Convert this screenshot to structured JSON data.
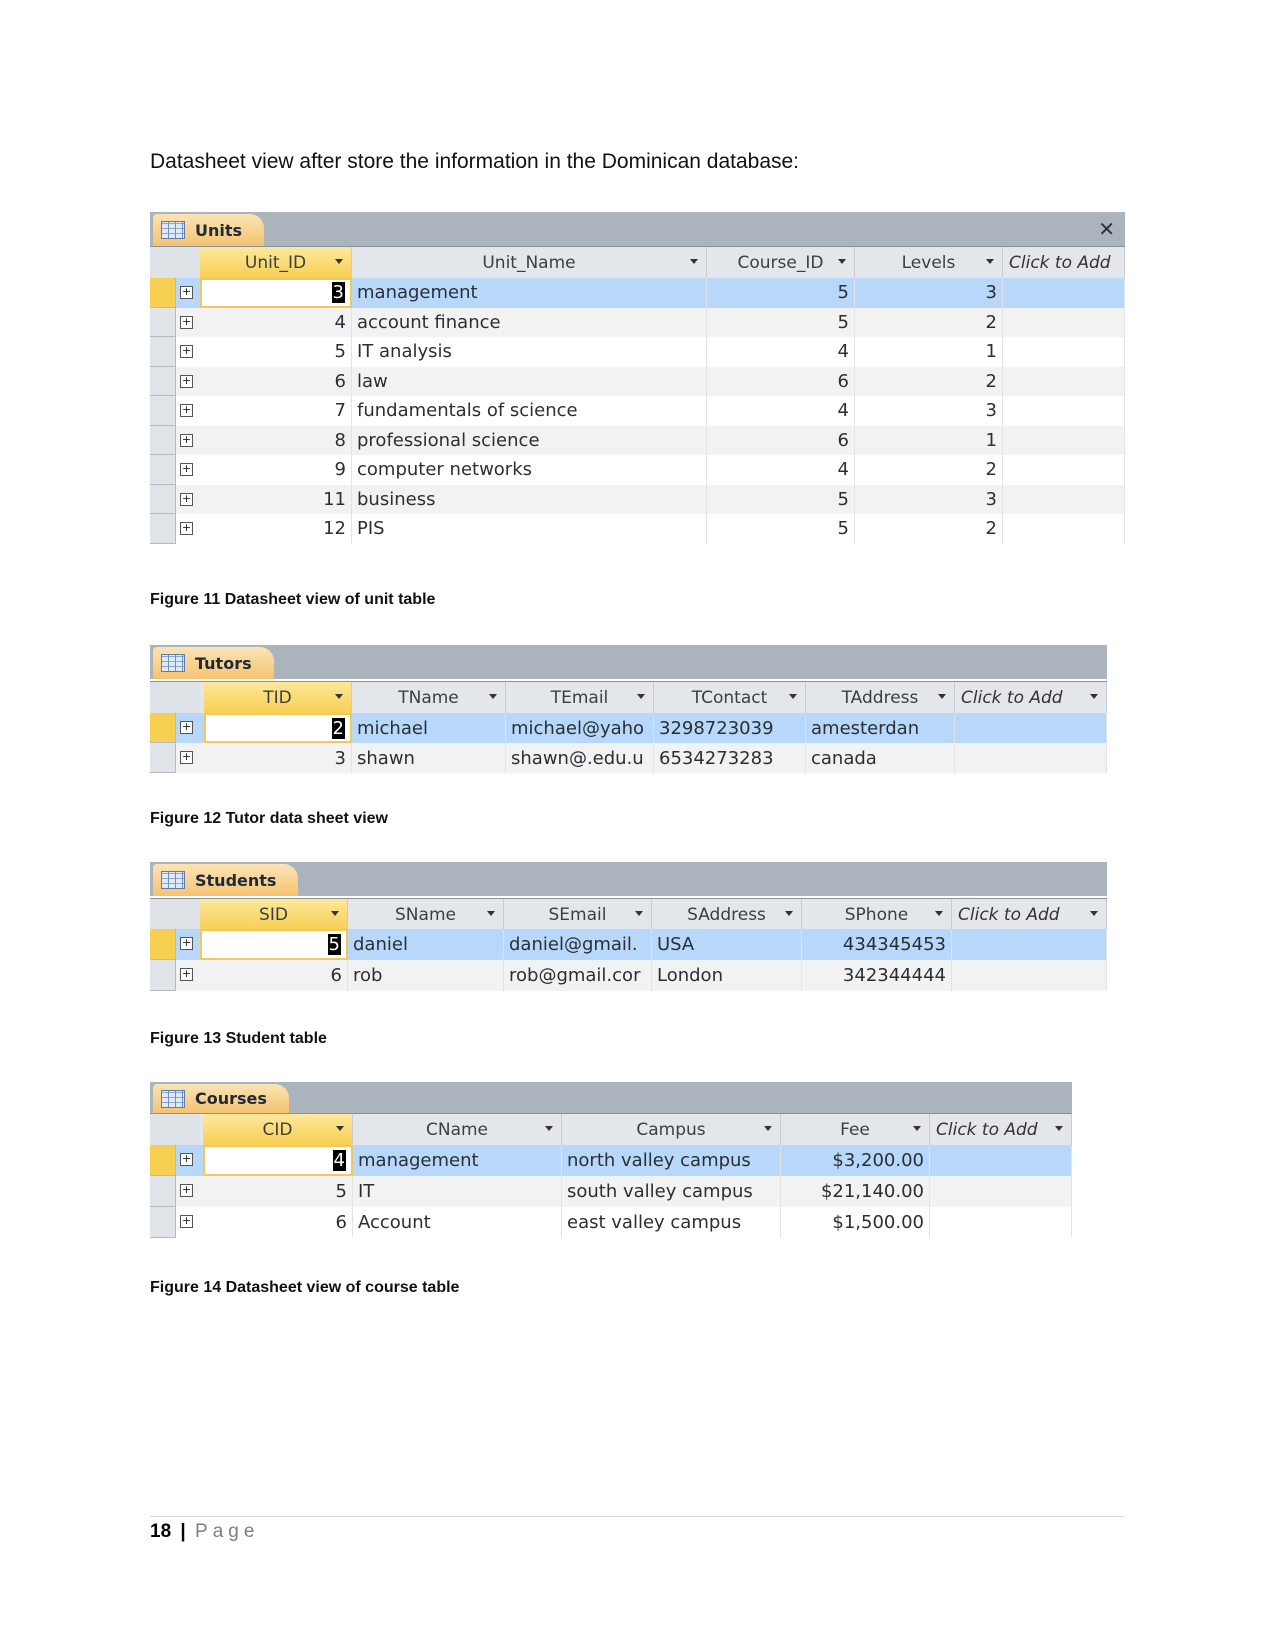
{
  "intro": "Datasheet view after store the information in the Dominican database:",
  "tables": {
    "units": {
      "title": "Units",
      "close_icon": "close-icon",
      "columns": [
        "Unit_ID",
        "Unit_Name",
        "Course_ID",
        "Levels",
        "Click to Add"
      ],
      "rows": [
        [
          "3",
          "management",
          "5",
          "3"
        ],
        [
          "4",
          "account finance",
          "5",
          "2"
        ],
        [
          "5",
          "IT analysis",
          "4",
          "1"
        ],
        [
          "6",
          "law",
          "6",
          "2"
        ],
        [
          "7",
          "fundamentals of science",
          "4",
          "3"
        ],
        [
          "8",
          "professional science",
          "6",
          "1"
        ],
        [
          "9",
          "computer networks",
          "4",
          "2"
        ],
        [
          "11",
          "business",
          "5",
          "3"
        ],
        [
          "12",
          "PIS",
          "5",
          "2"
        ]
      ]
    },
    "tutors": {
      "title": "Tutors",
      "columns": [
        "TID",
        "TName",
        "TEmail",
        "TContact",
        "TAddress",
        "Click to Add"
      ],
      "rows": [
        [
          "2",
          "michael",
          "michael@yaho",
          "3298723039",
          "amesterdan"
        ],
        [
          "3",
          "shawn",
          "shawn@.edu.u",
          "6534273283",
          "canada"
        ]
      ]
    },
    "students": {
      "title": "Students",
      "columns": [
        "SID",
        "SName",
        "SEmail",
        "SAddress",
        "SPhone",
        "Click to Add"
      ],
      "rows": [
        [
          "5",
          "daniel",
          "daniel@gmail.",
          "USA",
          "434345453"
        ],
        [
          "6",
          "rob",
          "rob@gmail.cor",
          "London",
          "342344444"
        ]
      ]
    },
    "courses": {
      "title": "Courses",
      "columns": [
        "CID",
        "CName",
        "Campus",
        "Fee",
        "Click to Add"
      ],
      "rows": [
        [
          "4",
          "management",
          "north valley campus",
          "$3,200.00"
        ],
        [
          "5",
          "IT",
          "south valley campus",
          "$21,140.00"
        ],
        [
          "6",
          "Account",
          "east valley campus",
          "$1,500.00"
        ]
      ]
    }
  },
  "captions": {
    "fig11": "Figure 11 Datasheet view of unit table",
    "fig12": "Figure 12 Tutor data sheet view",
    "fig13": "Figure 13 Student table",
    "fig14": "Figure 14 Datasheet view of course table"
  },
  "footer": {
    "page_number": "18",
    "separator": "|",
    "page_label": "Page"
  }
}
